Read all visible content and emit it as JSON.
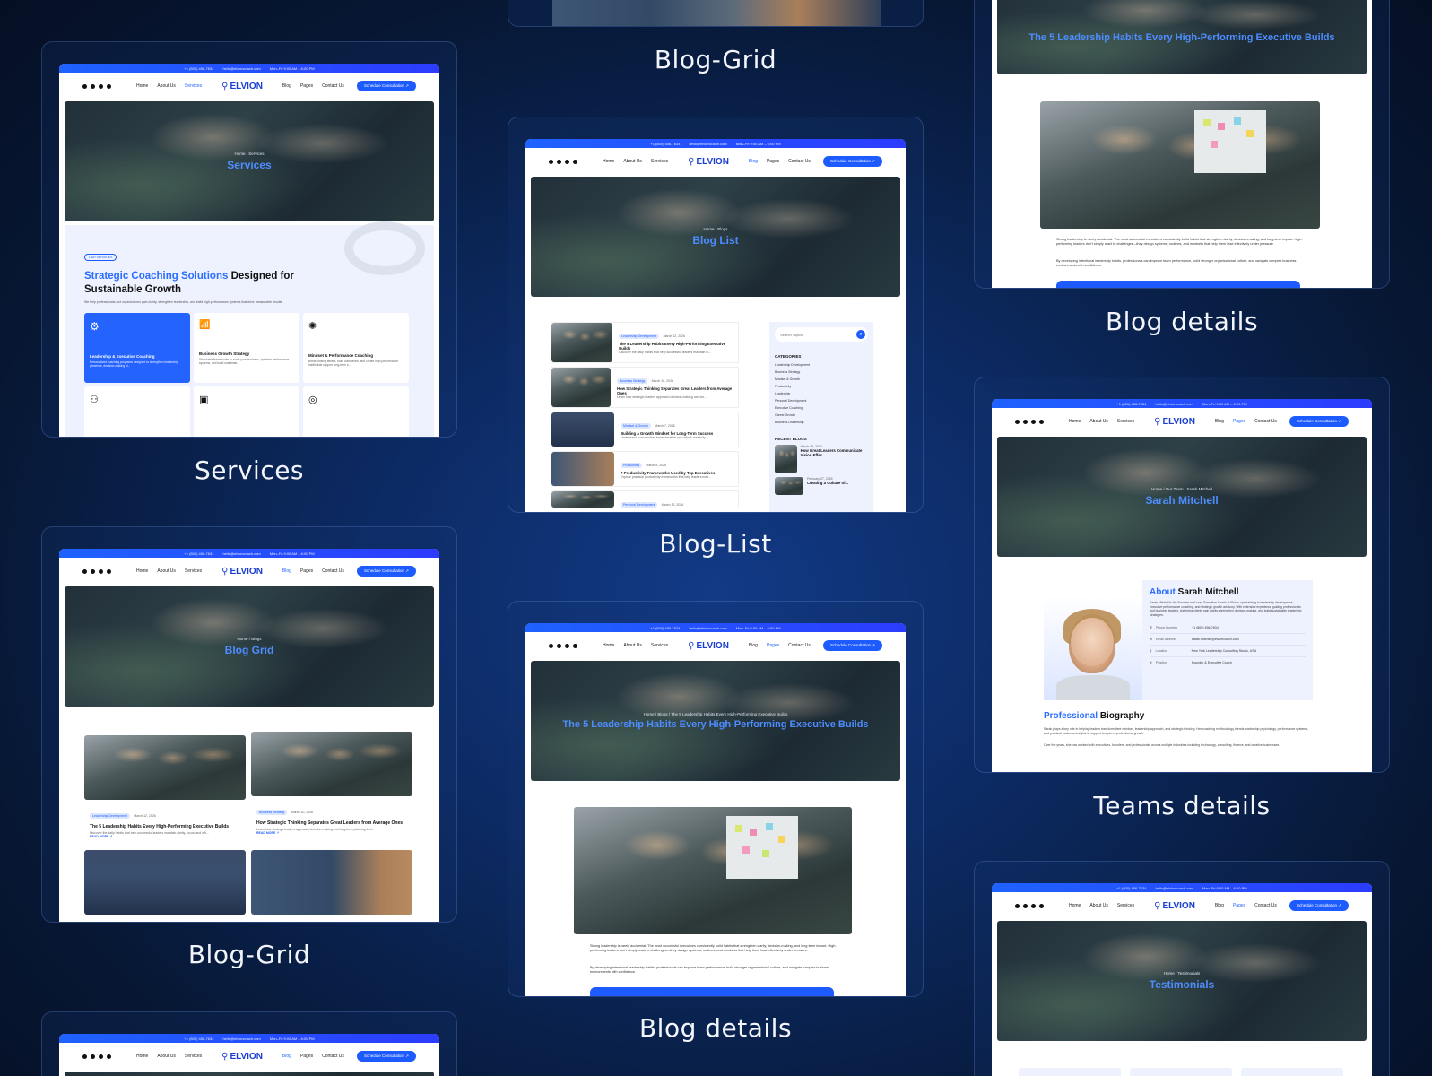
{
  "site": {
    "topbar": [
      "+1 (800) 456-7634",
      "hello@elvioncoach.com",
      "Mon–Fri 9:00 AM – 6:00 PM"
    ],
    "logo": "ELVION",
    "nav": [
      "Home",
      "About Us",
      "Services",
      "Blog",
      "Pages",
      "Contact Us"
    ],
    "cta": "Schedule Consultation ↗"
  },
  "cards": {
    "services": {
      "caption": "Services",
      "crumb": "Home / Services",
      "hero_title": "Services",
      "badge": "OUR SERVICES",
      "heading_blue": "Strategic Coaching Solutions",
      "heading_rest": "Designed for Sustainable Growth",
      "intro": "We help professionals and organizations gain clarity, strengthen leadership, and build high-performance systems that drive measurable results.",
      "items": [
        {
          "title": "Leadership & Executive Coaching",
          "desc": "Personalized coaching programs designed to strengthen leadership presence, decision-making cl..."
        },
        {
          "title": "Business Growth Strategy",
          "desc": "Structured frameworks to scale your business, optimize performance systems, and build sustainab..."
        },
        {
          "title": "Mindset & Performance Coaching",
          "desc": "Break limiting beliefs, build confidence, and create high-performance habits that support long-term s..."
        }
      ]
    },
    "blog_grid": {
      "caption": "Blog-Grid",
      "crumb": "Home / Blogs",
      "hero_title": "Blog Grid",
      "posts": [
        {
          "tag": "Leadership Development",
          "date": "March 12, 2026",
          "title": "The 5 Leadership Habits Every High-Performing Executive Builds",
          "desc": "Discover the daily habits that help successful leaders maintain clarity, focus, and infl...",
          "more": "READ MORE ↗"
        },
        {
          "tag": "Business Strategy",
          "date": "March 10, 2026",
          "title": "How Strategic Thinking Separates Great Leaders from Average Ones",
          "desc": "Learn how strategic leaders approach decision-making and long-term planning to d...",
          "more": "READ MORE ↗"
        }
      ]
    },
    "blog_grid_top": {
      "caption": "Blog-Grid"
    },
    "blog_list": {
      "caption": "Blog-List",
      "crumb": "Home / Blogs",
      "hero_title": "Blog List",
      "search_placeholder": "Search Topics",
      "categories_title": "CATEGORIES",
      "categories": [
        "Leadership Development",
        "Business Strategy",
        "Mindset & Growth",
        "Productivity",
        "Leadership",
        "Personal Development",
        "Executive Coaching",
        "Career Growth",
        "Business Leadership"
      ],
      "recent_title": "RECENT BLOGS",
      "recent": [
        {
          "date": "March 08, 2026",
          "title": "How Great Leaders Communicate Vision Effec..."
        },
        {
          "date": "February 27, 2026",
          "title": "Creating a Culture of..."
        }
      ],
      "posts": [
        {
          "tag": "Leadership Development",
          "date": "March 12, 2026",
          "title": "The 5 Leadership Habits Every High-Performing Executive Builds",
          "desc": "Discover the daily habits that help successful leaders maintain cl..."
        },
        {
          "tag": "Business Strategy",
          "date": "March 10, 2026",
          "title": "How Strategic Thinking Separates Great Leaders from Average Ones",
          "desc": "Learn how strategic leaders approach decision-making and lon..."
        },
        {
          "tag": "Mindset & Growth",
          "date": "March 7, 2026",
          "title": "Building a Growth Mindset for Long-Term Success",
          "desc": "Understand how mindset transformation can unlock creativity, r..."
        },
        {
          "tag": "Productivity",
          "date": "March 5, 2026",
          "title": "7 Productivity Frameworks Used by Top Executives",
          "desc": "Explore practical productivity frameworks that help leaders man..."
        },
        {
          "tag": "Personal Development",
          "date": "March 12, 2026",
          "title": "",
          "desc": ""
        }
      ]
    },
    "blog_details_center": {
      "caption": "Blog details",
      "crumb": "Home / Blogs / The 5 Leadership Habits Every High-Performing Executive Builds",
      "hero_title": "The 5 Leadership Habits Every High-Performing Executive Builds",
      "para1": "Strong leadership is rarely accidental. The most successful executives consistently build habits that strengthen clarity, decision-making, and long-term impact. High-performing leaders don't simply react to challenges—they design systems, routines, and mindsets that help them lead effectively under pressure.",
      "para2": "By developing intentional leadership habits, professionals can improve team performance, build stronger organizational culture, and navigate complex business environments with confidence."
    },
    "blog_details_right": {
      "caption": "Blog details",
      "hero_title": "The 5 Leadership Habits Every High-Performing Executive Builds",
      "para1": "Strong leadership is rarely accidental. The most successful executives consistently build habits that strengthen clarity, decision-making, and long-term impact. High-performing leaders don't simply react to challenges—they design systems, routines, and mindsets that help them lead effectively under pressure.",
      "para2": "By developing intentional leadership habits, professionals can improve team performance, build stronger organizational culture, and navigate complex business environments with confidence."
    },
    "teams_details": {
      "caption": "Teams details",
      "crumb": "Home / Our Team / Sarah Mitchell",
      "hero_title": "Sarah Mitchell",
      "about_blue": "About",
      "about_rest": "Sarah Mitchell",
      "about_text": "Sarah Mitchell is the Founder and Lead Executive Coach at Elvion, specializing in leadership development, executive performance coaching, and strategic growth advisory. With extensive experience guiding professionals and business leaders, she helps clients gain clarity, strengthen decision-making, and build sustainable leadership strategies.",
      "fields": [
        {
          "label": "Phone Number",
          "value": "+1 (800) 456-7634"
        },
        {
          "label": "Email Address",
          "value": "sarah.mitchell@elvioncoach.com"
        },
        {
          "label": "Location",
          "value": "New York Leadership Consulting Studio, USA"
        },
        {
          "label": "Position",
          "value": "Founder & Executive Coach"
        }
      ],
      "bio_blue": "Professional",
      "bio_rest": "Biography",
      "bio_text1": "Sarah plays a key role in helping leaders transform their mindset, leadership approach, and strategic thinking. Her coaching methodology blends leadership psychology, performance systems, and practical business insights to support long-term professional growth.",
      "bio_text2": "Over the years, she has worked with executives, founders, and professionals across multiple industries including technology, consulting, finance, and creative businesses."
    },
    "testimonials": {
      "caption": "",
      "crumb": "Home / Testimonials",
      "hero_title": "Testimonials"
    }
  }
}
